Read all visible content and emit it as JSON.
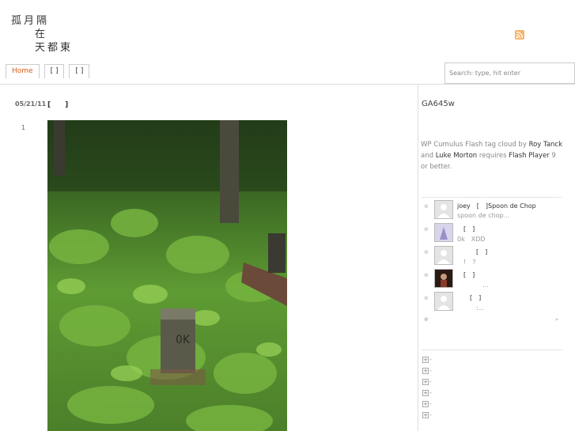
{
  "site": {
    "title_line1": "孤月隔",
    "title_line2": "在",
    "title_line3": "天都東"
  },
  "nav": {
    "items": [
      "Home",
      "[ ]",
      "[ ]"
    ]
  },
  "search": {
    "placeholder": "Search: type, hit enter"
  },
  "post": {
    "date": "05/21/11",
    "title": "[　　]",
    "comment_count": "1"
  },
  "sidebar": {
    "widget_title": "GA645w",
    "cumulus": {
      "prefix": "WP Cumulus Flash tag cloud by ",
      "author1": "Roy Tanck",
      "and": " and ",
      "author2": "Luke Morton",
      "requires": " requires ",
      "player": "Flash Player",
      "suffix": " 9 or better."
    },
    "comments": [
      {
        "line1": "joey　[　]Spoon de Chop",
        "line2": "spoon de chop..."
      },
      {
        "line1": "　[　]",
        "line2": "0k　XDD"
      },
      {
        "line1": "　　　[　]",
        "line2": "　!　?"
      },
      {
        "line1": "　[　]",
        "line2": "　　　　..."
      },
      {
        "line1": "　　[　]",
        "line2": "　　　:..."
      }
    ],
    "more_right": "»",
    "categories": [
      "-",
      "-",
      "-",
      "-",
      "-",
      "-"
    ]
  },
  "colors": {
    "accent": "#d85a1a",
    "rss": "#f7b46a"
  }
}
